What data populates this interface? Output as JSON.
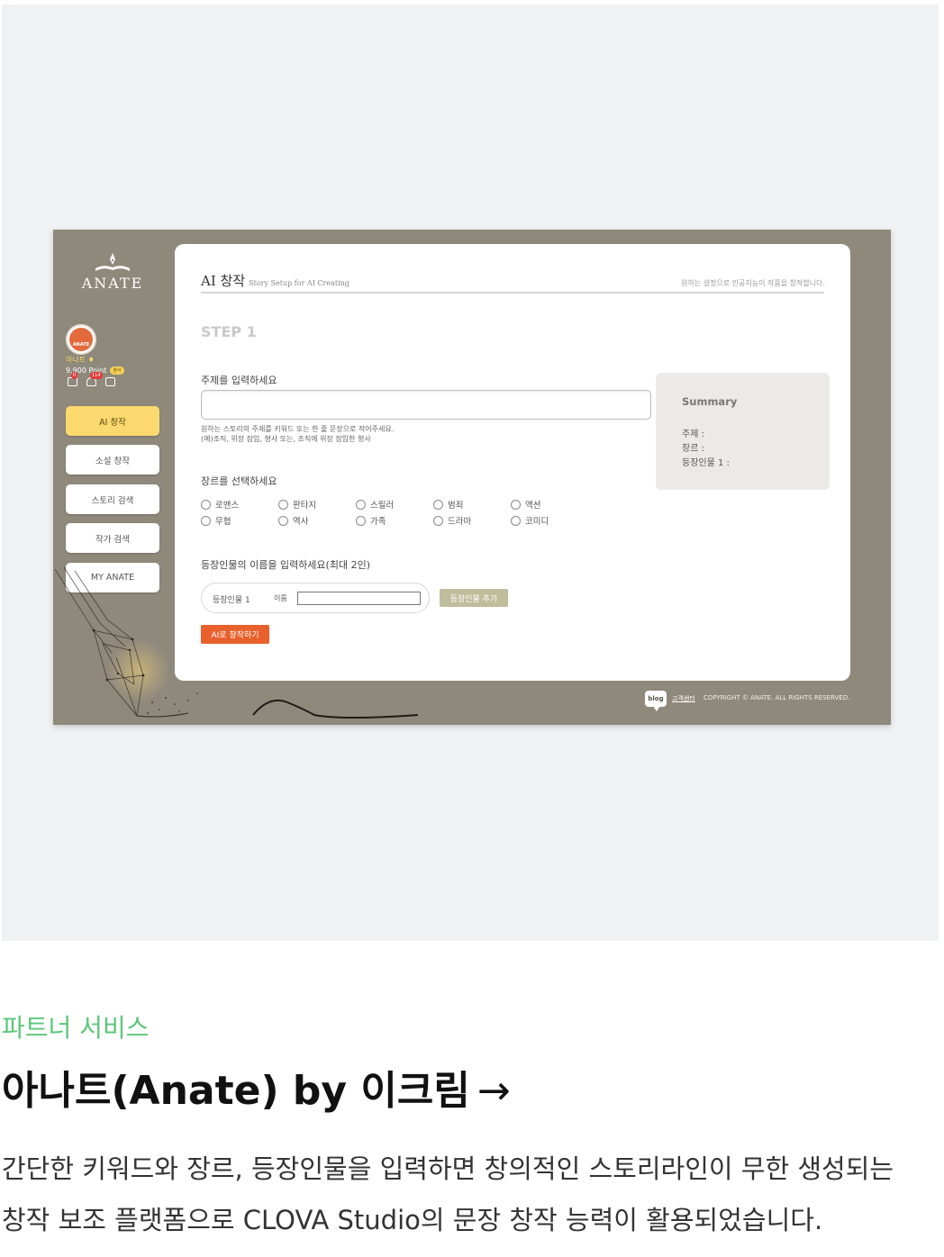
{
  "screenshot": {
    "sidebar": {
      "logo_text": "ANATE",
      "avatar_text": "ANATE",
      "user_name": "아나트 ♦",
      "user_points": "9,900 Point",
      "attend_badge": "출석",
      "badge_messages": "0",
      "badge_alerts": "114",
      "menu": [
        {
          "label": "AI 창작",
          "active": true
        },
        {
          "label": "소설 창작",
          "active": false
        },
        {
          "label": "스토리 검색",
          "active": false
        },
        {
          "label": "작가 검색",
          "active": false
        },
        {
          "label": "MY ANATE",
          "active": false
        }
      ]
    },
    "card": {
      "title": "AI 창작",
      "subtitle": "Story Setup for AI Creating",
      "description": "원하는 설정으로 인공지능이 작품을 창작합니다.",
      "step": "STEP 1",
      "topic": {
        "label": "주제를 입력하세요",
        "value": "",
        "hint_1": "원하는 스토리의 주제를 키워드 또는 한 줄 문장으로 적어주세요.",
        "hint_2": "(예)조직, 위장 잠입, 형사 또는, 조직에 위장 잠입한 형사"
      },
      "genre": {
        "label": "장르를 선택하세요",
        "options": [
          "로맨스",
          "판타지",
          "스릴러",
          "범죄",
          "액션",
          "무협",
          "역사",
          "가족",
          "드라마",
          "코미디"
        ]
      },
      "characters": {
        "label": "등장인물의 이름을 입력하세요(최대 2인)",
        "char_label": "등장인물 1",
        "name_label": "이름",
        "name_value": "",
        "add_button": "등장인물 추가"
      },
      "create_button": "AI로 창작하기",
      "summary": {
        "title": "Summary",
        "topic": "주제 :",
        "genre": "장르 :",
        "character": "등장인물 1 :"
      }
    },
    "footer": {
      "blog_icon_text": "blog",
      "support_link": "고객센터",
      "copyright": "COPYRIGHT © ANATE. ALL RIGHTS RESERVED."
    }
  },
  "caption": {
    "eyebrow": "파트너 서비스",
    "headline": "아나트(Anate) by 이크림",
    "headline_arrow": "→",
    "body_line_1": "간단한 키워드와 장르, 등장인물을 입력하면 창의적인 스토리라인이 무한 생성되는",
    "body_line_2": "창작 보조 플랫폼으로 CLOVA Studio의 문장 창작 능력이 활용되었습니다."
  },
  "colors": {
    "frame": "#8f897c",
    "accent_menu": "#fbd96e",
    "create_button": "#e8602c",
    "add_button": "#bfbd9c",
    "eyebrow": "#5cc779"
  }
}
